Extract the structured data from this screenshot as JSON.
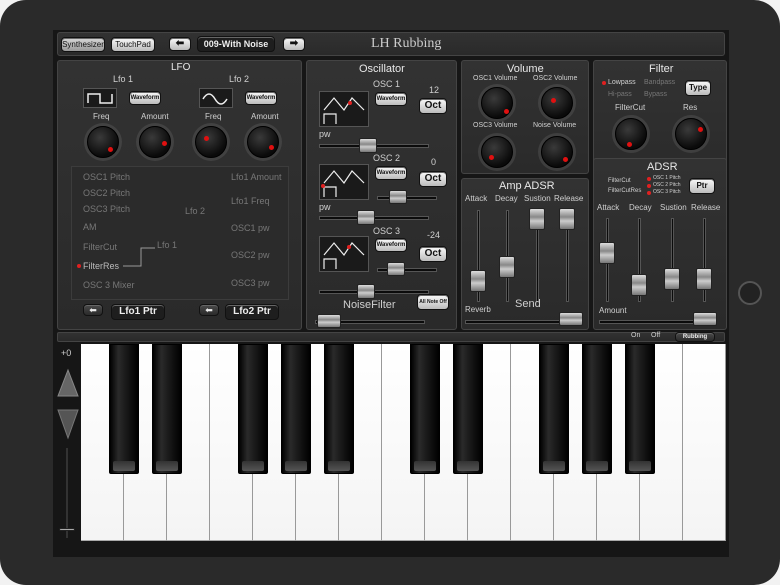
{
  "header": {
    "tab_synth": "Synthesizer",
    "tab_touch": "TouchPad",
    "preset": "009-With Noise",
    "title": "LH Rubbing"
  },
  "lfo": {
    "title": "LFO",
    "lfo1": "Lfo 1",
    "lfo2": "Lfo 2",
    "waveform": "Waveform",
    "freq": "Freq",
    "amount": "Amount",
    "targets_left": [
      "OSC1 Pitch",
      "OSC2 Pitch",
      "OSC3 Pitch",
      "AM",
      "FilterCut",
      "FilterRes",
      "OSC 3 Mixer"
    ],
    "targets_right": [
      "Lfo1 Amount",
      "Lfo1 Freq",
      "OSC1 pw",
      "OSC2 pw",
      "OSC3 pw"
    ],
    "route_lfo2": "Lfo 2",
    "route_lfo1": "Lfo 1",
    "ptr1": "Lfo1 Ptr",
    "ptr2": "Lfo2 Ptr"
  },
  "osc": {
    "title": "Oscillator",
    "osc1": "OSC 1",
    "osc2": "OSC 2",
    "osc3": "OSC 3",
    "waveform": "Waveform",
    "pw": "pw",
    "oct": "Oct",
    "oct1": "12",
    "oct2": "0",
    "oct3": "-24",
    "noise": "NoiseFilter",
    "allnote": "All Note Off"
  },
  "volume": {
    "title": "Volume",
    "osc1": "OSC1 Volume",
    "osc2": "OSC2 Volume",
    "osc3": "OSC3 Volume",
    "noise": "Noise Volume"
  },
  "filter": {
    "title": "Filter",
    "lowpass": "Lowpass",
    "bandpass": "Bandpass",
    "hipass": "Hi-pass",
    "bypass": "Bypass",
    "type": "Type",
    "cut": "FilterCut",
    "res": "Res"
  },
  "amp": {
    "title": "Amp ADSR",
    "attack": "Attack",
    "decay": "Decay",
    "sustain": "Sustion",
    "release": "Release",
    "reverb": "Reverb",
    "send": "Send"
  },
  "adsr": {
    "title": "ADSR",
    "filtercut": "FilterCut",
    "filtercutres": "FilterCutRes",
    "p1": "OSC 1 Pitch",
    "p2": "OSC 2 Pitch",
    "p3": "OSC 3 Pitch",
    "ptr": "Ptr",
    "attack": "Attack",
    "decay": "Decay",
    "sustain": "Sustion",
    "release": "Release",
    "amount": "Amount"
  },
  "statusbar": {
    "on": "On",
    "off": "Off",
    "mode": "Rubbing"
  },
  "keyboard": {
    "octave": "+0"
  },
  "colors": {
    "accent": "#e01010",
    "panel": "#2e2e2e"
  }
}
